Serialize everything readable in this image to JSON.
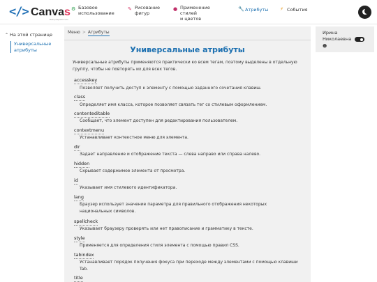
{
  "header": {
    "logo_mark": "</>",
    "logo_word_main": "Canva",
    "logo_word_s": "s",
    "logo_sub": "Веб-разработчик",
    "nav": [
      {
        "label_1": "Базовое",
        "label_2": "использование",
        "icon": "gear-icon",
        "glyph": "⚙",
        "color": "#2a9d4b"
      },
      {
        "label_1": "Рисование",
        "label_2": "фигур",
        "icon": "shapes-icon",
        "glyph": "✎",
        "color": "#d63b6b"
      },
      {
        "label_1": "Применение стилей",
        "label_2": "и цветов",
        "icon": "palette-icon",
        "glyph": "●",
        "color": "#c0306a"
      },
      {
        "label_1": "Атрибуты",
        "label_2": "",
        "icon": "wrench-icon",
        "glyph": "🔧",
        "color": "#1b6fb0"
      },
      {
        "label_1": "События",
        "label_2": "",
        "icon": "bolt-icon",
        "glyph": "⚡",
        "color": "#e89a1b"
      }
    ]
  },
  "sidebar": {
    "toc_title": "На этой странице",
    "toc_link": "Универсальные атрибуты"
  },
  "breadcrumb": {
    "home": "Меню",
    "sep": ">",
    "current": "Атрибуты"
  },
  "main": {
    "title": "Универсальные атрибуты",
    "intro": "Универсальные атрибуты применяются практически ко всем тегам, поэтому выделены в отдельную группу, чтобы не повторять их для всех тегов.",
    "attributes": [
      {
        "name": "accesskey",
        "desc": "Позволяет получить доступ к элементу с помощью заданного сочетания клавиш."
      },
      {
        "name": "class",
        "desc": "Определяет имя класса, которое позволяет связать тег со стилевым оформлением."
      },
      {
        "name": "contenteditable",
        "desc": "Сообщает, что элемент доступен для редактирования пользователем."
      },
      {
        "name": "contextmenu",
        "desc": "Устанавливает контекстное меню для элемента."
      },
      {
        "name": "dir",
        "desc": "Задает направление и отображение текста — слева направо или справа налево."
      },
      {
        "name": "hidden",
        "desc": "Скрывает содержимое элемента от просмотра."
      },
      {
        "name": "id",
        "desc": "Указывает имя стилевого идентификатора."
      },
      {
        "name": "lang",
        "desc": "Браузер использует значение параметра для правильного отображения некоторых национальных символов."
      },
      {
        "name": "spellcheck",
        "desc": "Указывает браузеру проверять или нет правописание и грамматику в тексте."
      },
      {
        "name": "style",
        "desc": "Применяется для определения стиля элемента с помощью правил CSS."
      },
      {
        "name": "tabindex",
        "desc": "Устанавливает порядок получения фокуса при переходе между элементами с помощью клавиши Tab."
      },
      {
        "name": "title",
        "desc": ""
      }
    ]
  },
  "user": {
    "name": "Ирина Николаевна",
    "icon": "user-icon",
    "toggle_state": "on"
  }
}
